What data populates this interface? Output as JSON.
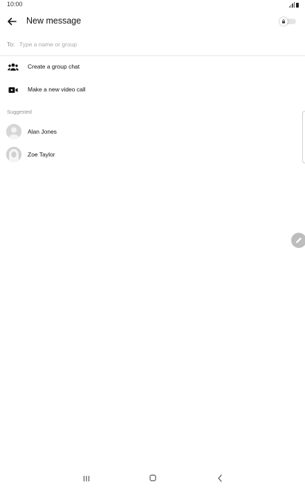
{
  "status_bar": {
    "time": "10:00",
    "signal_icon": "signal-icon",
    "battery_icon": "battery-icon"
  },
  "header": {
    "back_icon": "arrow-left-icon",
    "title": "New message",
    "secret_toggle_icon": "lock-icon",
    "secret_toggle_on": false
  },
  "recipient": {
    "label": "To:",
    "value": "",
    "placeholder": "Type a name or group"
  },
  "actions": [
    {
      "label": "Create a group chat",
      "icon": "group-icon"
    },
    {
      "label": "Make a new video call",
      "icon": "video-camera-icon"
    }
  ],
  "suggested": {
    "header": "Suggested",
    "contacts": [
      {
        "name": "Alan Jones",
        "avatar": "default-avatar"
      },
      {
        "name": "Zoe Taylor",
        "avatar": "default-avatar"
      }
    ]
  },
  "floating": {
    "compose_icon": "pencil-icon"
  },
  "nav_bar": {
    "recents_icon": "recents-icon",
    "home_icon": "home-icon",
    "back_icon": "chevron-left-icon"
  },
  "colors": {
    "background": "#ffffff",
    "text_primary": "#111111",
    "text_secondary": "#8f8f8f",
    "fab": "#bdbdbd"
  }
}
